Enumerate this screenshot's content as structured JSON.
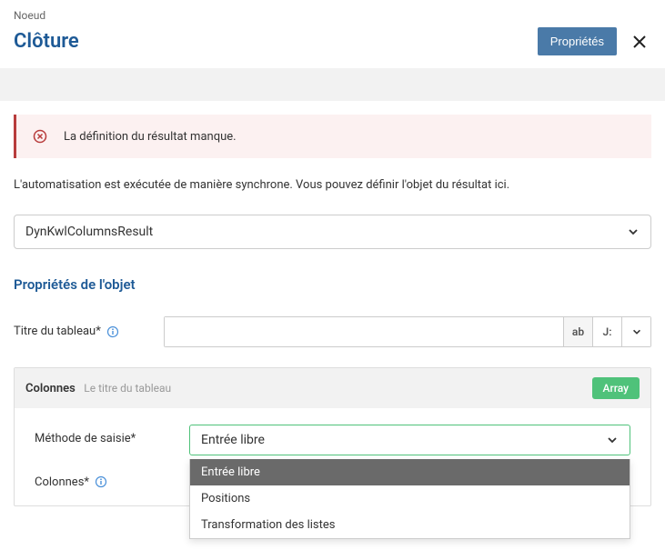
{
  "header": {
    "breadcrumb": "Noeud",
    "title": "Clôture",
    "properties_button": "Propriétés"
  },
  "alert": {
    "message": "La définition du résultat manque."
  },
  "description": "L'automatisation est exécutée de manière synchrone. Vous pouvez définir l'objet du résultat ici.",
  "result_select": {
    "value": "DynKwlColumnsResult"
  },
  "section": {
    "title": "Propriétés de l'objet"
  },
  "fields": {
    "table_title": {
      "label": "Titre du tableau*",
      "value": "",
      "ab_addon": "ab",
      "j_addon": "J:"
    }
  },
  "panel": {
    "title": "Colonnes",
    "subtitle": "Le titre du tableau",
    "badge": "Array",
    "input_method": {
      "label": "Méthode de saisie*",
      "value": "Entrée libre",
      "options": [
        "Entrée libre",
        "Positions",
        "Transformation des listes"
      ]
    },
    "columns": {
      "label": "Colonnes*"
    }
  }
}
